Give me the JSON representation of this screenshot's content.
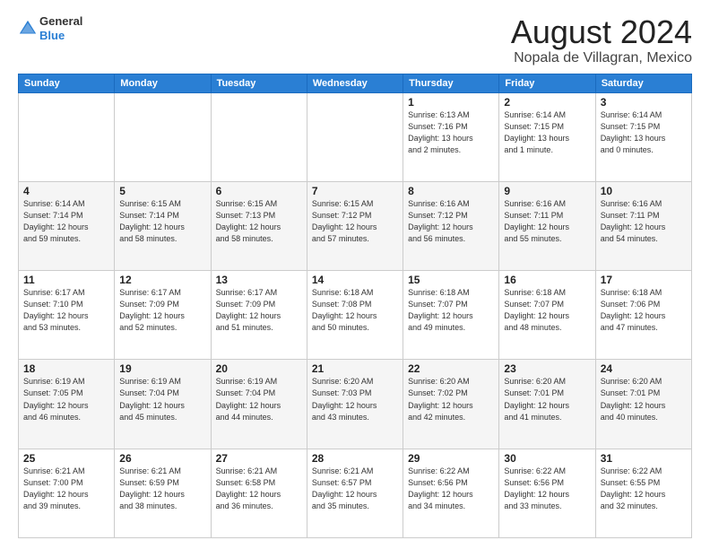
{
  "header": {
    "logo_line1": "General",
    "logo_line2": "Blue",
    "month_year": "August 2024",
    "location": "Nopala de Villagran, Mexico"
  },
  "days_of_week": [
    "Sunday",
    "Monday",
    "Tuesday",
    "Wednesday",
    "Thursday",
    "Friday",
    "Saturday"
  ],
  "weeks": [
    [
      {
        "day": "",
        "info": ""
      },
      {
        "day": "",
        "info": ""
      },
      {
        "day": "",
        "info": ""
      },
      {
        "day": "",
        "info": ""
      },
      {
        "day": "1",
        "info": "Sunrise: 6:13 AM\nSunset: 7:16 PM\nDaylight: 13 hours\nand 2 minutes."
      },
      {
        "day": "2",
        "info": "Sunrise: 6:14 AM\nSunset: 7:15 PM\nDaylight: 13 hours\nand 1 minute."
      },
      {
        "day": "3",
        "info": "Sunrise: 6:14 AM\nSunset: 7:15 PM\nDaylight: 13 hours\nand 0 minutes."
      }
    ],
    [
      {
        "day": "4",
        "info": "Sunrise: 6:14 AM\nSunset: 7:14 PM\nDaylight: 12 hours\nand 59 minutes."
      },
      {
        "day": "5",
        "info": "Sunrise: 6:15 AM\nSunset: 7:14 PM\nDaylight: 12 hours\nand 58 minutes."
      },
      {
        "day": "6",
        "info": "Sunrise: 6:15 AM\nSunset: 7:13 PM\nDaylight: 12 hours\nand 58 minutes."
      },
      {
        "day": "7",
        "info": "Sunrise: 6:15 AM\nSunset: 7:12 PM\nDaylight: 12 hours\nand 57 minutes."
      },
      {
        "day": "8",
        "info": "Sunrise: 6:16 AM\nSunset: 7:12 PM\nDaylight: 12 hours\nand 56 minutes."
      },
      {
        "day": "9",
        "info": "Sunrise: 6:16 AM\nSunset: 7:11 PM\nDaylight: 12 hours\nand 55 minutes."
      },
      {
        "day": "10",
        "info": "Sunrise: 6:16 AM\nSunset: 7:11 PM\nDaylight: 12 hours\nand 54 minutes."
      }
    ],
    [
      {
        "day": "11",
        "info": "Sunrise: 6:17 AM\nSunset: 7:10 PM\nDaylight: 12 hours\nand 53 minutes."
      },
      {
        "day": "12",
        "info": "Sunrise: 6:17 AM\nSunset: 7:09 PM\nDaylight: 12 hours\nand 52 minutes."
      },
      {
        "day": "13",
        "info": "Sunrise: 6:17 AM\nSunset: 7:09 PM\nDaylight: 12 hours\nand 51 minutes."
      },
      {
        "day": "14",
        "info": "Sunrise: 6:18 AM\nSunset: 7:08 PM\nDaylight: 12 hours\nand 50 minutes."
      },
      {
        "day": "15",
        "info": "Sunrise: 6:18 AM\nSunset: 7:07 PM\nDaylight: 12 hours\nand 49 minutes."
      },
      {
        "day": "16",
        "info": "Sunrise: 6:18 AM\nSunset: 7:07 PM\nDaylight: 12 hours\nand 48 minutes."
      },
      {
        "day": "17",
        "info": "Sunrise: 6:18 AM\nSunset: 7:06 PM\nDaylight: 12 hours\nand 47 minutes."
      }
    ],
    [
      {
        "day": "18",
        "info": "Sunrise: 6:19 AM\nSunset: 7:05 PM\nDaylight: 12 hours\nand 46 minutes."
      },
      {
        "day": "19",
        "info": "Sunrise: 6:19 AM\nSunset: 7:04 PM\nDaylight: 12 hours\nand 45 minutes."
      },
      {
        "day": "20",
        "info": "Sunrise: 6:19 AM\nSunset: 7:04 PM\nDaylight: 12 hours\nand 44 minutes."
      },
      {
        "day": "21",
        "info": "Sunrise: 6:20 AM\nSunset: 7:03 PM\nDaylight: 12 hours\nand 43 minutes."
      },
      {
        "day": "22",
        "info": "Sunrise: 6:20 AM\nSunset: 7:02 PM\nDaylight: 12 hours\nand 42 minutes."
      },
      {
        "day": "23",
        "info": "Sunrise: 6:20 AM\nSunset: 7:01 PM\nDaylight: 12 hours\nand 41 minutes."
      },
      {
        "day": "24",
        "info": "Sunrise: 6:20 AM\nSunset: 7:01 PM\nDaylight: 12 hours\nand 40 minutes."
      }
    ],
    [
      {
        "day": "25",
        "info": "Sunrise: 6:21 AM\nSunset: 7:00 PM\nDaylight: 12 hours\nand 39 minutes."
      },
      {
        "day": "26",
        "info": "Sunrise: 6:21 AM\nSunset: 6:59 PM\nDaylight: 12 hours\nand 38 minutes."
      },
      {
        "day": "27",
        "info": "Sunrise: 6:21 AM\nSunset: 6:58 PM\nDaylight: 12 hours\nand 36 minutes."
      },
      {
        "day": "28",
        "info": "Sunrise: 6:21 AM\nSunset: 6:57 PM\nDaylight: 12 hours\nand 35 minutes."
      },
      {
        "day": "29",
        "info": "Sunrise: 6:22 AM\nSunset: 6:56 PM\nDaylight: 12 hours\nand 34 minutes."
      },
      {
        "day": "30",
        "info": "Sunrise: 6:22 AM\nSunset: 6:56 PM\nDaylight: 12 hours\nand 33 minutes."
      },
      {
        "day": "31",
        "info": "Sunrise: 6:22 AM\nSunset: 6:55 PM\nDaylight: 12 hours\nand 32 minutes."
      }
    ]
  ]
}
